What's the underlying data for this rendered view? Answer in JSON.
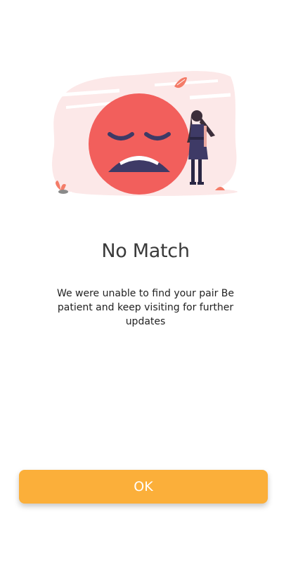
{
  "empty_state": {
    "illustration": {
      "icon": "crying-face-woman-illustration",
      "face_color": "#F25F5C",
      "accent_color": "#FCE8E8",
      "figure_color": "#3E3A66"
    },
    "title": "No Match",
    "message": "We were unable to find your pair Be patient and keep visiting for further updates"
  },
  "actions": {
    "ok_label": "OK",
    "ok_color": "#FBAF3A"
  }
}
